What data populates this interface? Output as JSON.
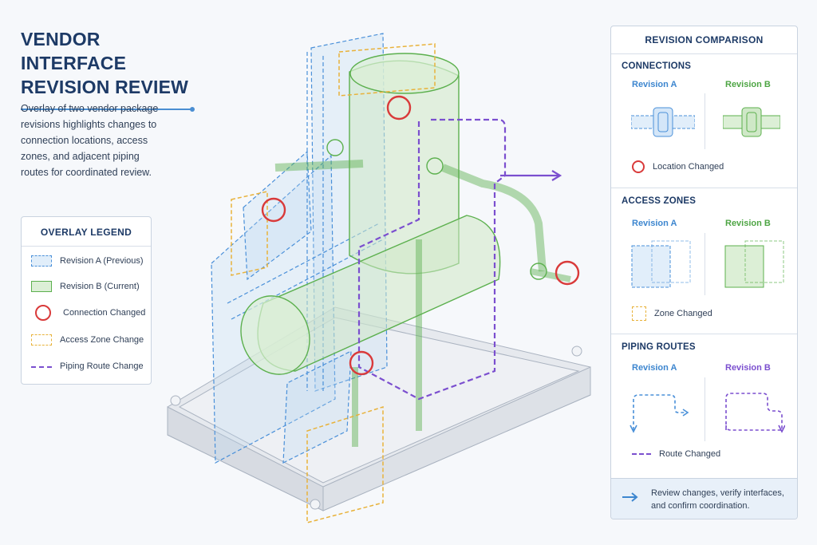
{
  "header": {
    "title_line1": "VENDOR INTERFACE",
    "title_line2": "REVISION REVIEW",
    "description": "Overlay of two vendor package revisions highlights changes to connection locations, access zones, and adjacent piping routes for coordinated review."
  },
  "legend": {
    "title": "OVERLAY LEGEND",
    "items": [
      {
        "label": "Revision A (Previous)",
        "icon": "dashed-blue-box"
      },
      {
        "label": "Revision B (Current)",
        "icon": "solid-green-box"
      },
      {
        "label": "Connection Changed",
        "icon": "red-circle"
      },
      {
        "label": "Access Zone Change",
        "icon": "dashed-yellow-box"
      },
      {
        "label": "Piping Route Change",
        "icon": "dashed-purple-line"
      }
    ]
  },
  "panel": {
    "title": "REVISION COMPARISON",
    "connections": {
      "title": "CONNECTIONS",
      "rev_a": "Revision A",
      "rev_b": "Revision B",
      "note": "Location Changed"
    },
    "access_zones": {
      "title": "ACCESS ZONES",
      "rev_a": "Revision A",
      "rev_b": "Revision B",
      "note": "Zone Changed"
    },
    "piping_routes": {
      "title": "PIPING ROUTES",
      "rev_a": "Revision A",
      "rev_b": "Revision B",
      "note": "Route Changed"
    },
    "footer": "Review changes, verify interfaces, and confirm coordination."
  },
  "colors": {
    "revision_a": "#4a90d9",
    "revision_b": "#5cb04e",
    "connection_changed": "#d93a3a",
    "zone_changed": "#e8b23a",
    "route_changed": "#7b4fcf",
    "title": "#1d3a66"
  }
}
